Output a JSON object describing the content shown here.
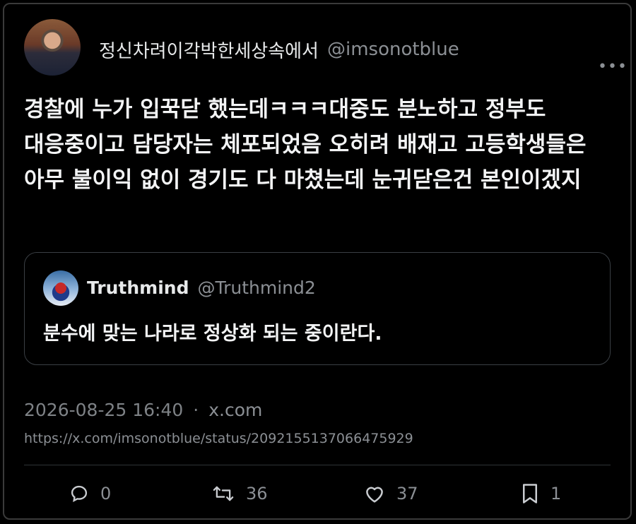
{
  "tweet": {
    "display_name": "정신차려이각박한세상속에서",
    "handle": "@imsonotblue",
    "more_icon": "more-dots-icon",
    "text": "경찰에 누가 입꾹닫 했는데ㅋㅋㅋ대중도 분노하고 정부도 대응중이고 담당자는 체포되었음 오히려 배재고 고등학생들은 아무 불이익 없이 경기도 다 마쳤는데 눈귀닫은건 본인이겠지",
    "timestamp": "2026-08-25 16:40",
    "separator": "·",
    "source": "x.com",
    "url": "https://x.com/imsonotblue/status/2092155137066475929"
  },
  "quote": {
    "display_name": "Truthmind",
    "handle": "@Truthmind2",
    "text": "분수에 맞는 나라로 정상화 되는 중이란다."
  },
  "actions": {
    "replies": "0",
    "reposts": "36",
    "likes": "37",
    "bookmarks": "1"
  },
  "colors": {
    "background": "#000000",
    "text": "#e7e9ea",
    "muted": "#8b8f94",
    "border": "#3a3f44"
  }
}
